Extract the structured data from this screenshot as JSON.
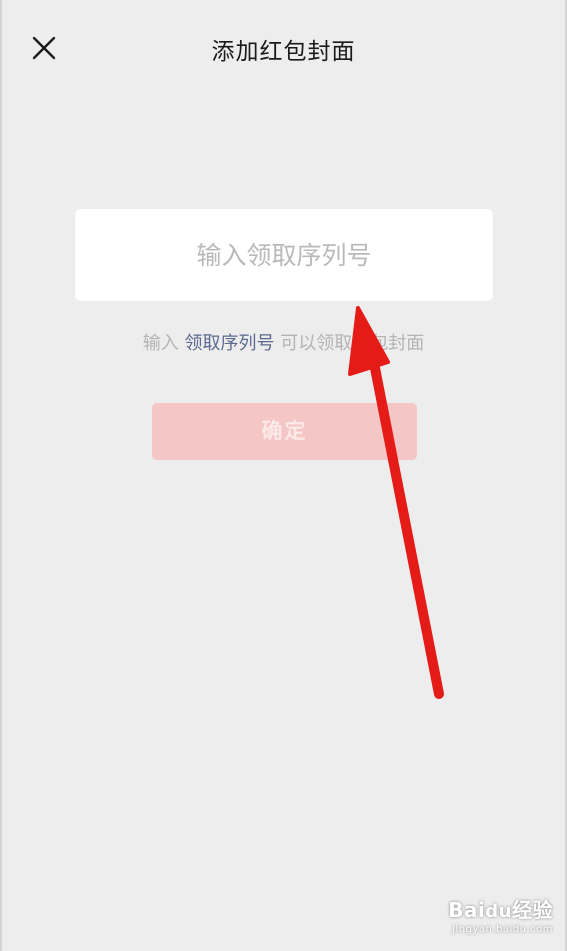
{
  "header": {
    "title": "添加红包封面",
    "close_icon": "close-icon"
  },
  "form": {
    "input_placeholder": "输入领取序列号",
    "input_value": "",
    "hint_prefix": "输入 ",
    "hint_link": "领取序列号",
    "hint_suffix": " 可以领取红包封面",
    "confirm_label": "确定",
    "confirm_disabled": true
  },
  "annotation": {
    "arrow_color": "#e51b17",
    "arrow_icon": "red-arrow"
  },
  "watermark": {
    "brand_a": "Bai",
    "brand_b": "du",
    "brand_c": "经验",
    "sub": "jingyan.baidu.com"
  },
  "colors": {
    "background": "#ededed",
    "button_disabled": "#f4c6c5",
    "link": "#5b6a91"
  }
}
